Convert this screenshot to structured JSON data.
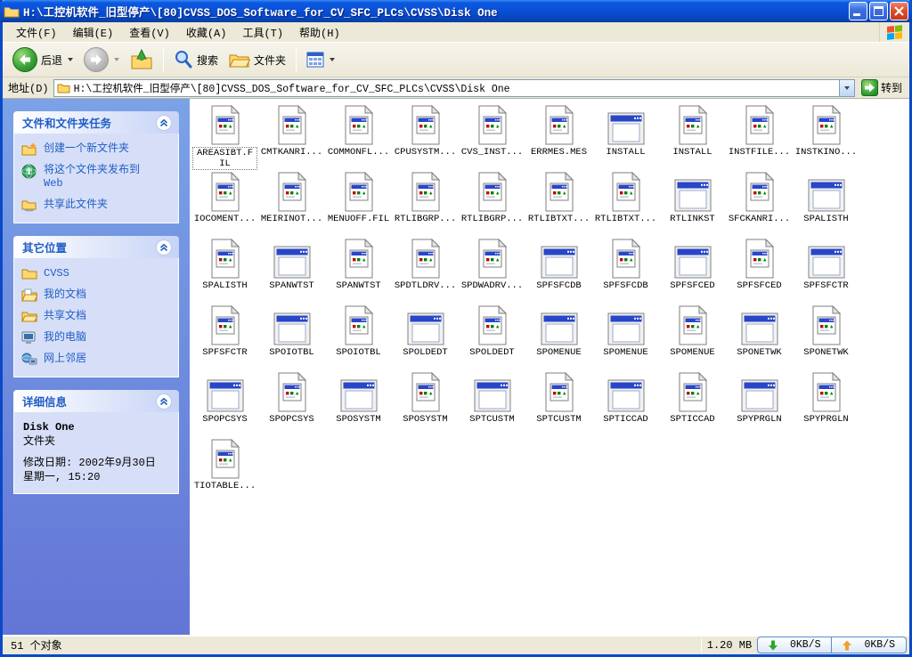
{
  "window": {
    "title": "H:\\工控机软件_旧型停产\\[80]CVSS_DOS_Software_for_CV_SFC_PLCs\\CVSS\\Disk One",
    "controls": {
      "minimize": "minimize",
      "maximize": "maximize",
      "close": "close"
    }
  },
  "menu": {
    "items": [
      {
        "label": "文件(F)"
      },
      {
        "label": "编辑(E)"
      },
      {
        "label": "查看(V)"
      },
      {
        "label": "收藏(A)"
      },
      {
        "label": "工具(T)"
      },
      {
        "label": "帮助(H)"
      }
    ]
  },
  "toolbar": {
    "back_label": "后退",
    "search_label": "搜索",
    "folders_label": "文件夹",
    "icons": [
      "back-icon",
      "forward-icon",
      "up-folder-icon",
      "search-icon",
      "folders-icon",
      "views-icon"
    ]
  },
  "address": {
    "label": "地址(D)",
    "value": "H:\\工控机软件_旧型停产\\[80]CVSS_DOS_Software_for_CV_SFC_PLCs\\CVSS\\Disk One",
    "go_label": "转到"
  },
  "sidebar": {
    "tasks": {
      "title": "文件和文件夹任务",
      "items": [
        {
          "label": "创建一个新文件夹",
          "icon": "new-folder-icon"
        },
        {
          "label": "将这个文件夹发布到 Web",
          "icon": "publish-web-icon"
        },
        {
          "label": "共享此文件夹",
          "icon": "share-folder-icon"
        }
      ]
    },
    "places": {
      "title": "其它位置",
      "items": [
        {
          "label": "CVSS",
          "icon": "folder-icon"
        },
        {
          "label": "我的文档",
          "icon": "my-documents-icon"
        },
        {
          "label": "共享文档",
          "icon": "shared-documents-icon"
        },
        {
          "label": "我的电脑",
          "icon": "my-computer-icon"
        },
        {
          "label": "网上邻居",
          "icon": "network-places-icon"
        }
      ]
    },
    "details": {
      "title": "详细信息",
      "name": "Disk One",
      "type": "文件夹",
      "modified_line1": "修改日期: 2002年9月30日",
      "modified_line2": "星期一, 15:20"
    }
  },
  "files": [
    {
      "name": "AREASIBT.FIL",
      "icon": "file",
      "selected": true
    },
    {
      "name": "CMTKANRI...",
      "icon": "file"
    },
    {
      "name": "COMMONFL...",
      "icon": "file"
    },
    {
      "name": "CPUSYSTM...",
      "icon": "file"
    },
    {
      "name": "CVS_INST...",
      "icon": "file"
    },
    {
      "name": "ERRMES.MES",
      "icon": "file"
    },
    {
      "name": "INSTALL",
      "icon": "app"
    },
    {
      "name": "INSTALL",
      "icon": "file"
    },
    {
      "name": "INSTFILE...",
      "icon": "file"
    },
    {
      "name": "INSTKINO...",
      "icon": "file"
    },
    {
      "name": "IOCOMENT...",
      "icon": "file"
    },
    {
      "name": "MEIRINOT...",
      "icon": "file"
    },
    {
      "name": "MENUOFF.FIL",
      "icon": "file"
    },
    {
      "name": "RTLIBGRP...",
      "icon": "file"
    },
    {
      "name": "RTLIBGRP...",
      "icon": "file"
    },
    {
      "name": "RTLIBTXT...",
      "icon": "file"
    },
    {
      "name": "RTLIBTXT...",
      "icon": "file"
    },
    {
      "name": "RTLINKST",
      "icon": "app"
    },
    {
      "name": "SFCKANRI...",
      "icon": "file"
    },
    {
      "name": "SPALISTH",
      "icon": "app"
    },
    {
      "name": "SPALISTH",
      "icon": "file"
    },
    {
      "name": "SPANWTST",
      "icon": "app"
    },
    {
      "name": "SPANWTST",
      "icon": "file"
    },
    {
      "name": "SPDTLDRV...",
      "icon": "file"
    },
    {
      "name": "SPDWADRV...",
      "icon": "file"
    },
    {
      "name": "SPFSFCDB",
      "icon": "app"
    },
    {
      "name": "SPFSFCDB",
      "icon": "file"
    },
    {
      "name": "SPFSFCED",
      "icon": "app"
    },
    {
      "name": "SPFSFCED",
      "icon": "file"
    },
    {
      "name": "SPFSFCTR",
      "icon": "app"
    },
    {
      "name": "SPFSFCTR",
      "icon": "file"
    },
    {
      "name": "SPOIOTBL",
      "icon": "app"
    },
    {
      "name": "SPOIOTBL",
      "icon": "file"
    },
    {
      "name": "SPOLDEDT",
      "icon": "app"
    },
    {
      "name": "SPOLDEDT",
      "icon": "file"
    },
    {
      "name": "SPOMENUE",
      "icon": "app"
    },
    {
      "name": "SPOMENUE",
      "icon": "app"
    },
    {
      "name": "SPOMENUE",
      "icon": "file"
    },
    {
      "name": "SPONETWK",
      "icon": "app"
    },
    {
      "name": "SPONETWK",
      "icon": "file"
    },
    {
      "name": "SPOPCSYS",
      "icon": "app"
    },
    {
      "name": "SPOPCSYS",
      "icon": "file"
    },
    {
      "name": "SPOSYSTM",
      "icon": "app"
    },
    {
      "name": "SPOSYSTM",
      "icon": "file"
    },
    {
      "name": "SPTCUSTM",
      "icon": "app"
    },
    {
      "name": "SPTCUSTM",
      "icon": "file"
    },
    {
      "name": "SPTICCAD",
      "icon": "app"
    },
    {
      "name": "SPTICCAD",
      "icon": "file"
    },
    {
      "name": "SPYPRGLN",
      "icon": "app"
    },
    {
      "name": "SPYPRGLN",
      "icon": "file"
    },
    {
      "name": "TIOTABLE...",
      "icon": "file"
    }
  ],
  "statusbar": {
    "objects": "51 个对象",
    "size": "1.20 MB",
    "down_speed": "0KB/S",
    "up_speed": "0KB/S"
  },
  "colors": {
    "titlebar_blue": "#0B50D8",
    "taskpane_blue": "#6E8CDE",
    "panel_body": "#D6DFF7",
    "link_blue": "#215DC6",
    "icon_titlebar_blue": "#2846C8",
    "down_arrow_green": "#2BA52B",
    "up_arrow_orange": "#F0A030"
  }
}
